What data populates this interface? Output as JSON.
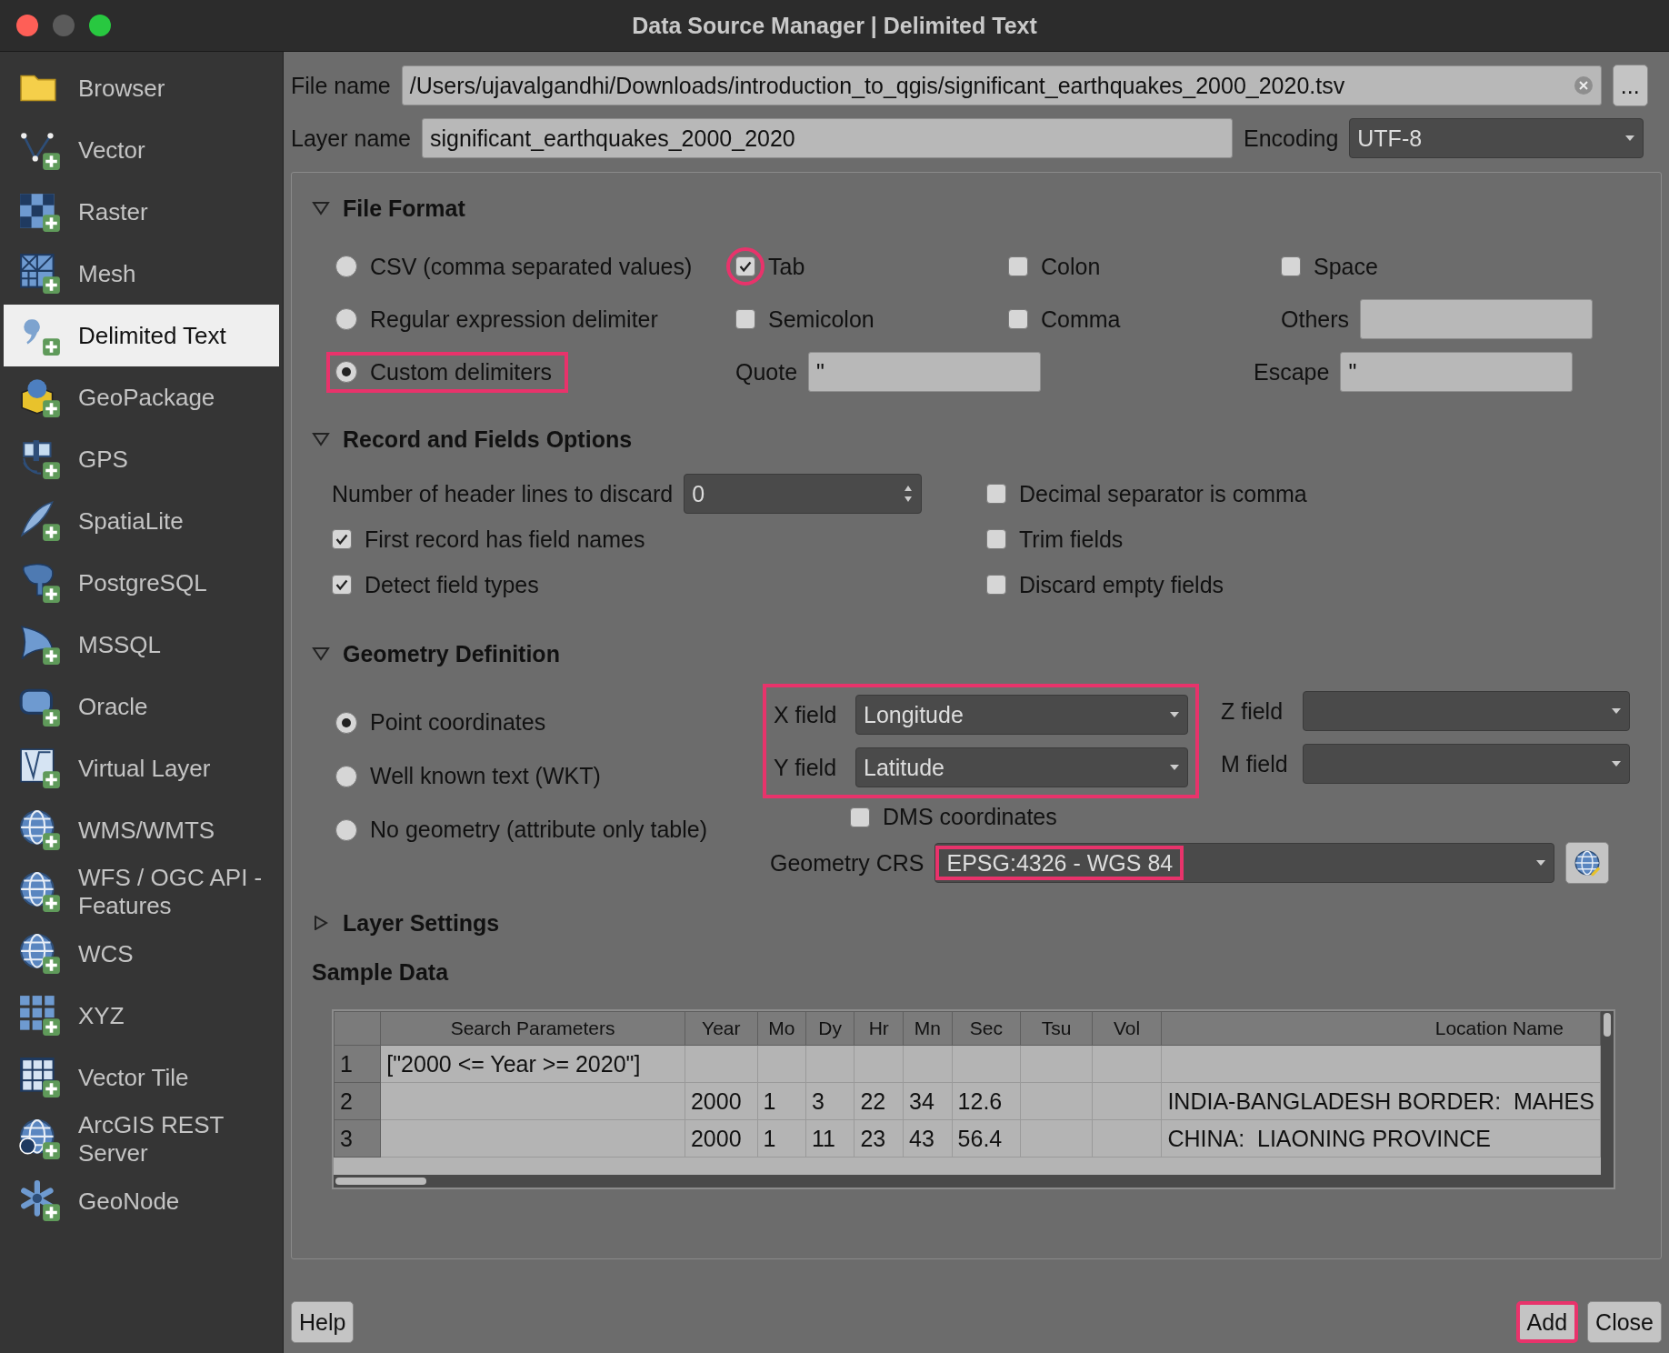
{
  "window": {
    "title": "Data Source Manager | Delimited Text"
  },
  "sidebar": {
    "items": [
      {
        "label": "Browser",
        "selected": false
      },
      {
        "label": "Vector",
        "selected": false
      },
      {
        "label": "Raster",
        "selected": false
      },
      {
        "label": "Mesh",
        "selected": false
      },
      {
        "label": "Delimited Text",
        "selected": true
      },
      {
        "label": "GeoPackage",
        "selected": false
      },
      {
        "label": "GPS",
        "selected": false
      },
      {
        "label": "SpatiaLite",
        "selected": false
      },
      {
        "label": "PostgreSQL",
        "selected": false
      },
      {
        "label": "MSSQL",
        "selected": false
      },
      {
        "label": "Oracle",
        "selected": false
      },
      {
        "label": "Virtual Layer",
        "selected": false
      },
      {
        "label": "WMS/WMTS",
        "selected": false
      },
      {
        "label": "WFS / OGC API - Features",
        "selected": false
      },
      {
        "label": "WCS",
        "selected": false
      },
      {
        "label": "XYZ",
        "selected": false
      },
      {
        "label": "Vector Tile",
        "selected": false
      },
      {
        "label": "ArcGIS REST Server",
        "selected": false
      },
      {
        "label": "GeoNode",
        "selected": false
      }
    ]
  },
  "file_name": {
    "label": "File name",
    "value": "/Users/ujavalgandhi/Downloads/introduction_to_qgis/significant_earthquakes_2000_2020.tsv",
    "browse": "..."
  },
  "layer_name": {
    "label": "Layer name",
    "value": "significant_earthquakes_2000_2020"
  },
  "encoding": {
    "label": "Encoding",
    "value": "UTF-8"
  },
  "file_format": {
    "title": "File Format",
    "expanded": true,
    "formats": [
      {
        "label": "CSV (comma separated values)",
        "selected": false,
        "highlighted": false
      },
      {
        "label": "Regular expression delimiter",
        "selected": false,
        "highlighted": false
      },
      {
        "label": "Custom delimiters",
        "selected": true,
        "highlighted": true
      }
    ],
    "delimiters": [
      {
        "label": "Tab",
        "checked": true,
        "highlighted": true
      },
      {
        "label": "Colon",
        "checked": false,
        "highlighted": false
      },
      {
        "label": "Space",
        "checked": false,
        "highlighted": false
      },
      {
        "label": "Semicolon",
        "checked": false,
        "highlighted": false
      },
      {
        "label": "Comma",
        "checked": false,
        "highlighted": false
      }
    ],
    "others": {
      "label": "Others"
    },
    "quote": {
      "label": "Quote",
      "value": "\""
    },
    "escape": {
      "label": "Escape",
      "value": "\""
    }
  },
  "record_options": {
    "title": "Record and Fields Options",
    "expanded": true,
    "header_lines": {
      "label": "Number of header lines to discard",
      "value": "0"
    },
    "options": [
      {
        "label": "Decimal separator is comma",
        "checked": false
      },
      {
        "label": "First record has field names",
        "checked": true
      },
      {
        "label": "Trim fields",
        "checked": false
      },
      {
        "label": "Detect field types",
        "checked": true
      },
      {
        "label": "Discard empty fields",
        "checked": false
      }
    ]
  },
  "geometry": {
    "title": "Geometry Definition",
    "expanded": true,
    "types": [
      {
        "label": "Point coordinates",
        "selected": true
      },
      {
        "label": "Well known text (WKT)",
        "selected": false
      },
      {
        "label": "No geometry (attribute only table)",
        "selected": false
      }
    ],
    "fields_highlighted": true,
    "x_field": {
      "label": "X field",
      "value": "Longitude"
    },
    "y_field": {
      "label": "Y field",
      "value": "Latitude"
    },
    "z_field": {
      "label": "Z field"
    },
    "m_field": {
      "label": "M field"
    },
    "dms": {
      "label": "DMS coordinates",
      "checked": false
    },
    "crs": {
      "label": "Geometry CRS",
      "value": "EPSG:4326 - WGS 84",
      "highlighted": true
    }
  },
  "layer_settings": {
    "title": "Layer Settings",
    "expanded": false
  },
  "sample_data": {
    "title": "Sample Data",
    "table": {
      "columns": [
        "Search Parameters",
        "Year",
        "Mo",
        "Dy",
        "Hr",
        "Mn",
        "Sec",
        "Tsu",
        "Vol",
        "Location Name"
      ],
      "rows": [
        {
          "number": "1",
          "cells": [
            "[\"2000 <= Year >= 2020\"]",
            null,
            null,
            null,
            null,
            null,
            null,
            null,
            null,
            null
          ]
        },
        {
          "number": "2",
          "cells": [
            null,
            "2000",
            "1",
            "3",
            "22",
            "34",
            "12.6",
            null,
            null,
            "INDIA-BANGLADESH BORDER:  MAHES"
          ]
        },
        {
          "number": "3",
          "cells": [
            null,
            "2000",
            "1",
            "11",
            "23",
            "43",
            "56.4",
            null,
            null,
            "CHINA:  LIAONING PROVINCE"
          ]
        }
      ]
    }
  },
  "buttons": [
    {
      "label": "Help",
      "highlighted": false
    },
    {
      "label": "Add",
      "highlighted": true
    },
    {
      "label": "Close",
      "highlighted": false
    }
  ]
}
